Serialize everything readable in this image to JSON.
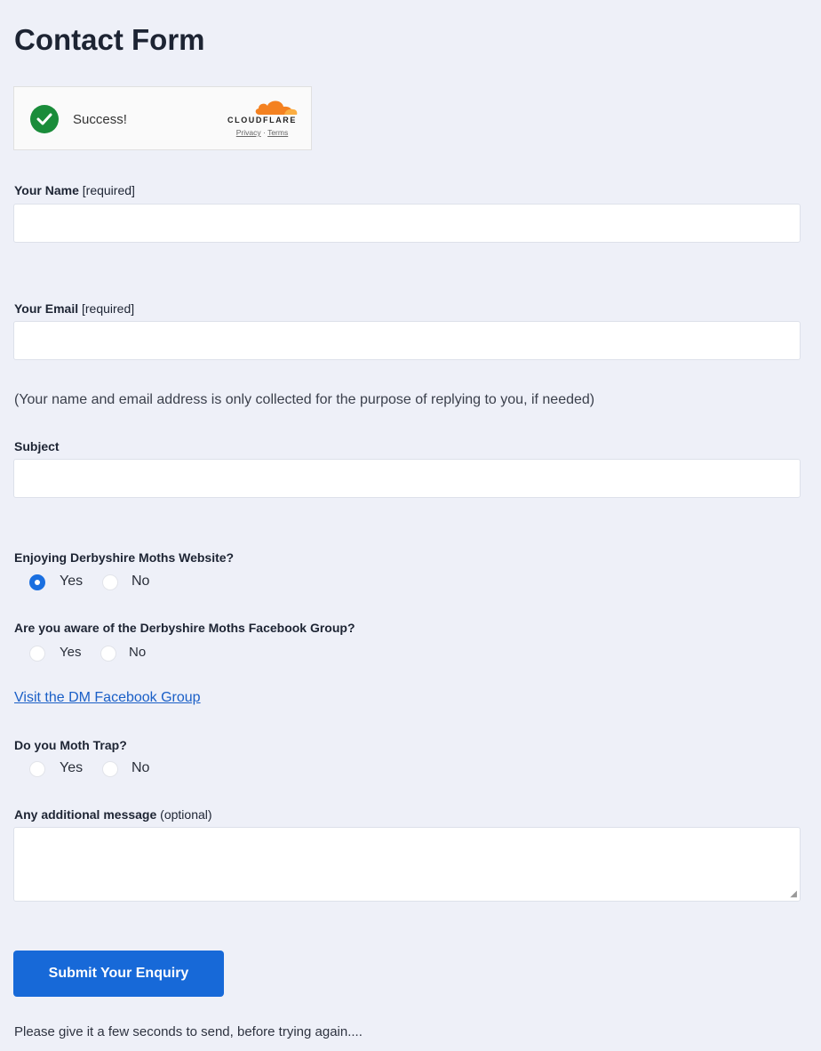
{
  "title": "Contact Form",
  "turnstile": {
    "status": "Success!",
    "brand": "CLOUDFLARE",
    "privacy": "Privacy",
    "separator": "·",
    "terms": "Terms",
    "check_color": "#1a8c3a",
    "cloud_color": "#f48120"
  },
  "fields": {
    "name": {
      "label": "Your Name",
      "suffix": "[required]",
      "value": "",
      "placeholder": ""
    },
    "email": {
      "label": "Your Email",
      "suffix": "[required]",
      "value": "",
      "placeholder": ""
    },
    "privacy_note": "(Your name and email address is only collected for the purpose of replying to you, if needed)",
    "subject": {
      "label": "Subject",
      "value": "",
      "placeholder": ""
    }
  },
  "questions": {
    "enjoying": {
      "label": "Enjoying Derbyshire Moths Website?",
      "yes": "Yes",
      "no": "No",
      "selected": "Yes"
    },
    "facebook": {
      "label": "Are you aware of the Derbyshire Moths Facebook Group?",
      "yes": "Yes",
      "no": "No",
      "selected": ""
    },
    "facebook_link": "Visit the DM Facebook Group",
    "trap": {
      "label": "Do you Moth Trap?",
      "yes": "Yes",
      "no": "No",
      "selected": ""
    }
  },
  "message": {
    "label": "Any additional message",
    "suffix": "(optional)",
    "value": ""
  },
  "submit_label": "Submit Your Enquiry",
  "footer_note": "Please give it a few seconds to send, before trying again....",
  "colors": {
    "accent": "#1769d8",
    "background": "#eef0f8",
    "link": "#1a5fc7"
  }
}
